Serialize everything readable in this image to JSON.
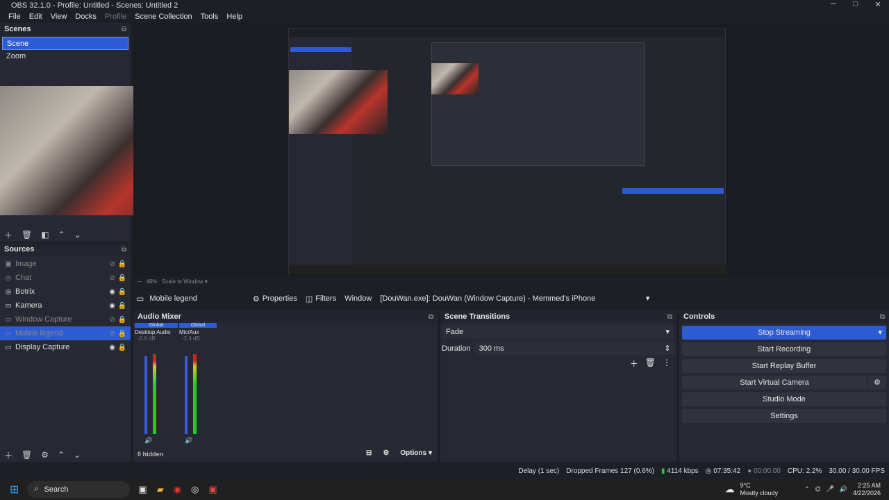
{
  "window": {
    "title": "OBS 32.1.0 - Profile: Untitled - Scenes: Untitled 2",
    "controls": {
      "minimize": "─",
      "maximize": "□",
      "close": "✕"
    }
  },
  "menu": {
    "file": "File",
    "edit": "Edit",
    "view": "View",
    "docks": "Docks",
    "profile": "Profile",
    "scene_collection": "Scene Collection",
    "tools": "Tools",
    "help": "Help"
  },
  "scenes": {
    "header": "Scenes",
    "items": [
      {
        "label": "Scene",
        "selected": true
      },
      {
        "label": "Zoom",
        "selected": false
      }
    ]
  },
  "sources": {
    "header": "Sources",
    "items": [
      {
        "label": "Image",
        "visible": false
      },
      {
        "label": "Chat",
        "visible": false
      },
      {
        "label": "Botrix",
        "visible": true
      },
      {
        "label": "Kamera",
        "visible": true
      },
      {
        "label": "Window Capture",
        "visible": false
      },
      {
        "label": "Mobile legend",
        "visible": false,
        "selected": true
      },
      {
        "label": "Display Capture",
        "visible": true
      }
    ]
  },
  "source_bar": {
    "name": "Mobile legend",
    "properties": "Properties",
    "filters": "Filters",
    "window_label": "Window",
    "window_value": "[DouWan.exe]: DouWan (Window Capture) - Memmed's iPhone"
  },
  "audio_mixer": {
    "header": "Audio Mixer",
    "channels": [
      {
        "tag": "Global",
        "name": "Desktop Audio",
        "db": "-2.6 dB"
      },
      {
        "tag": "Global",
        "name": "Mic/Aux",
        "db": "-2.4 dB"
      }
    ],
    "scale": [
      "0",
      "-6",
      "-12",
      "-18",
      "-24",
      "-30",
      "-36",
      "-42",
      "-48",
      "-54",
      "-60"
    ],
    "hidden": "0 hidden",
    "options": "Options"
  },
  "transitions": {
    "header": "Scene Transitions",
    "type": "Fade",
    "duration_label": "Duration",
    "duration_value": "300 ms"
  },
  "controls": {
    "header": "Controls",
    "stop_streaming": "Stop Streaming",
    "start_recording": "Start Recording",
    "start_replay": "Start Replay Buffer",
    "start_vcam": "Start Virtual Camera",
    "studio_mode": "Studio Mode",
    "settings": "Settings"
  },
  "status": {
    "delay": "Delay (1 sec)",
    "dropped": "Dropped Frames 127 (0.6%)",
    "kbps": "4114 kbps",
    "stream_time": "07:35:42",
    "rec_time": "00:00:00",
    "cpu": "CPU: 2.2%",
    "fps": "30.00 / 30.00 FPS"
  },
  "taskbar": {
    "search": "Search",
    "weather_temp": "9°C",
    "weather_desc": "Mostly cloudy",
    "time": "2:25 AM",
    "date": "4/22/2026"
  }
}
